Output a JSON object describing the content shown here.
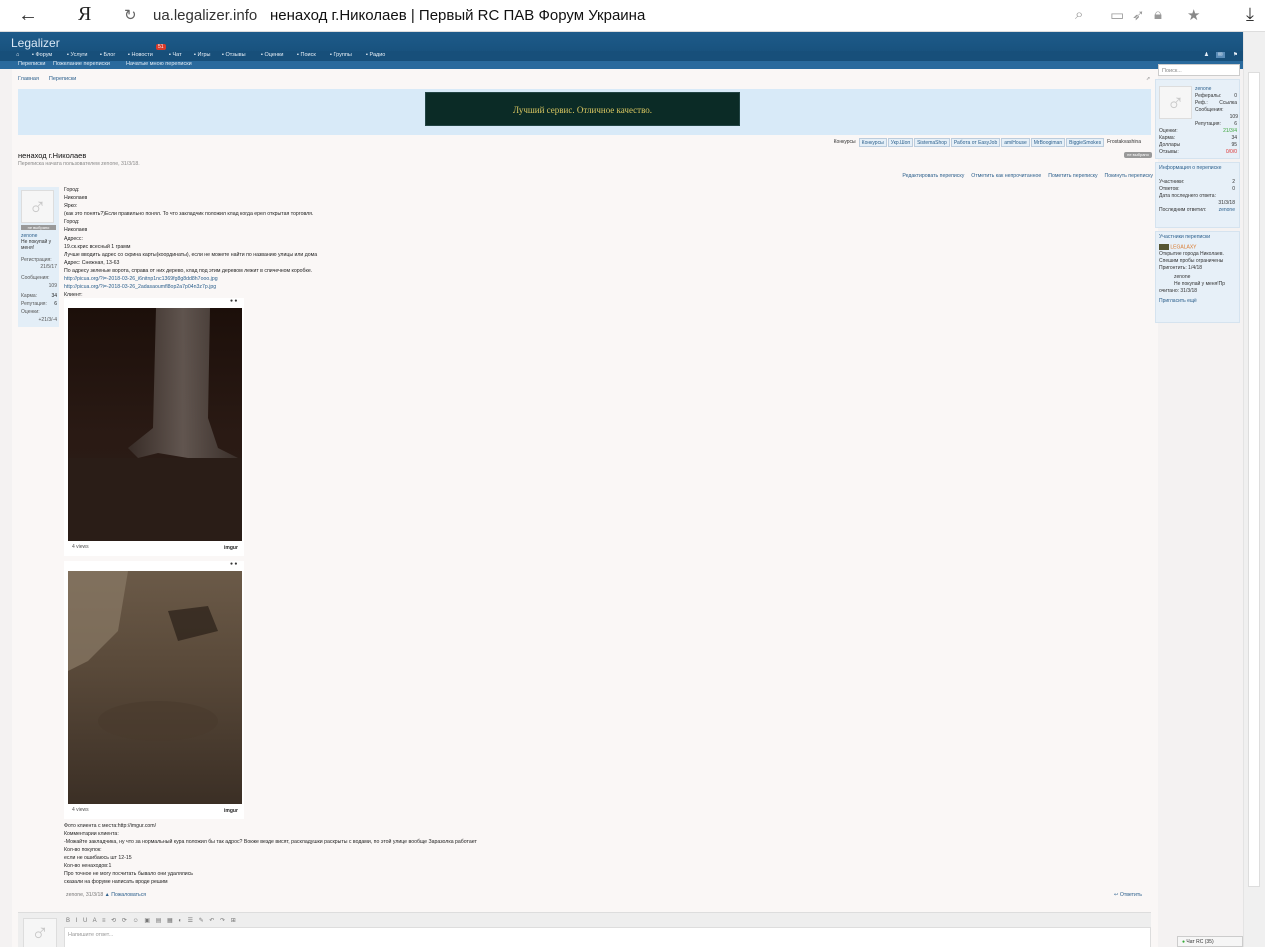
{
  "browser": {
    "logo": "Я",
    "domain": "ua.legalizer.info",
    "title": "ненаход г.Николаев | Первый RC ПАВ Форум Украина"
  },
  "forum": {
    "logo": "Legalizer",
    "nav": [
      {
        "label": "Форум"
      },
      {
        "label": "Услуги"
      },
      {
        "label": "Блог"
      },
      {
        "label": "Новости",
        "badge": "51"
      },
      {
        "label": "Чат"
      },
      {
        "label": "Игры"
      },
      {
        "label": "Отзывы"
      },
      {
        "label": "Оценки"
      },
      {
        "label": "Поиск"
      },
      {
        "label": "Группы"
      },
      {
        "label": "Радио"
      }
    ],
    "subnav": [
      "Переписки",
      "Пожелание переписки",
      "Начатые мною переписки"
    ]
  },
  "breadcrumbs": [
    "Главная",
    "Переписки"
  ],
  "banner": {
    "text": "Лучший сервис. Отличное качество."
  },
  "tabs": [
    "Конкурсы",
    "Конкурсы",
    "Укр.Шоп",
    "SistemaShop",
    "Работа от EasyJob",
    "amiHouse",
    "MrBoogiman",
    "BiggieSmokes",
    "Frostakvashina"
  ],
  "thread": {
    "title": "ненаход г.Николаев",
    "subtitle": "Переписка начата пользователем zenone, 31/3/18.",
    "subscribe": "не выбрано",
    "actions": [
      "Редактировать переписку",
      "Отметить как непрочитанное",
      "Пометить переписку",
      "Покинуть переписку"
    ]
  },
  "poster": {
    "badge": "не выбрано",
    "name": "zenone",
    "title": "Не покупай у меня!",
    "stats": [
      {
        "label": "Регистрация:",
        "value": "21/5/17"
      },
      {
        "label": "Сообщения:",
        "value": "109"
      },
      {
        "label": "Карма:",
        "value": "34"
      },
      {
        "label": "Репутация:",
        "value": "6"
      },
      {
        "label": "Оценки:",
        "value": "+21/3/-4"
      }
    ]
  },
  "post": {
    "lines": [
      "Город:",
      "Николаев",
      "Ярко:",
      "(как это понять?)Если правильно понял. То что закладчик положил клад когда ерел открытая торговля.",
      "Город:",
      "Николаев",
      "Адресс:",
      "19.ск.крис всесный 1 грамм",
      "Лучше вводить адрес со скрина карты(координаты), если не можете найти по названию улицы или дома",
      "Адрес: Снежная, 13-63",
      "По адресу зеленые ворота, справа от них дерево, клад под этим деревом лежит в спичечном коробке.",
      "http://picua.org/?i=-2018-03-26_i6nitnp1nc1369fg8g8dd8h7ooo.jpg",
      "http://picua.org/?i=-2018-03-26_2adasaoumfl8op2a7p04n3z7p.jpg",
      "Клиент:"
    ],
    "images": [
      {
        "views": "4 views",
        "brand": "imgur"
      },
      {
        "views": "4 views",
        "brand": "imgur"
      }
    ],
    "lines2": [
      "Фото клиента с места:http://imgur.com/",
      "Комментарии клиента:",
      "-Можайте закладчика, ну что за нормальный кура положил бы так адрос? Вокже везде висят, раскладушки раскрыты с водами, по этой улице вообще Заразолка работает",
      "Кол-во покупок:",
      "если не ошибаюсь шт 12-15",
      "Кол-во ненаходов:1",
      "Про точное не могу посчитать бывало они удалялись",
      "сказали на форуме написать вроде решим"
    ],
    "footer_author": "zenone, 31/3/18",
    "footer_report": "Пожаловаться",
    "reply": "Ответить"
  },
  "editor": {
    "toolbar": "B I U A ≡ ⟲ ⟳ ☺ ▣ ▤ ▦ ◐ ☰ ✎ ↶ ↷ ⊞",
    "placeholder": "Напишите ответ..."
  },
  "sidebar": {
    "search_placeholder": "Поиск...",
    "user": {
      "name": "zenone",
      "rows": [
        {
          "label": "Рефералы:",
          "value": "0"
        },
        {
          "label": "Реф.:",
          "value": "Ссылка"
        },
        {
          "label": "Сообщения:",
          "value": "109"
        },
        {
          "label": "Репутация:",
          "value": "6"
        },
        {
          "label": "Оценки:",
          "value": "21/3/4"
        },
        {
          "label": "Карма:",
          "value": "34"
        },
        {
          "label": "Доллары",
          "value": "95"
        },
        {
          "label": "Отзывы:",
          "value": "0/0/0"
        }
      ]
    },
    "info": {
      "title": "Информация о переписке",
      "rows": [
        {
          "label": "Участники:",
          "value": "2"
        },
        {
          "label": "Ответов:",
          "value": "0"
        },
        {
          "label": "Дата последнего ответа:",
          "value": "31/3/18"
        },
        {
          "label": "Последним ответил:",
          "value": "zenone"
        }
      ]
    },
    "participants": {
      "title": "Участники переписки",
      "p1_name": "LEGALAXY",
      "p1_text": "Открытие города Николаев. Спешим пробы ограничены",
      "p1_meta": "Пригонтить: 1/4/18",
      "p2_name": "zenone",
      "p2_text": "Не покупай у меня!Пр",
      "p2_meta": "очитано: 31/3/18",
      "invite": "Пригласить ещё"
    },
    "chat": "Чат RC (35)"
  }
}
